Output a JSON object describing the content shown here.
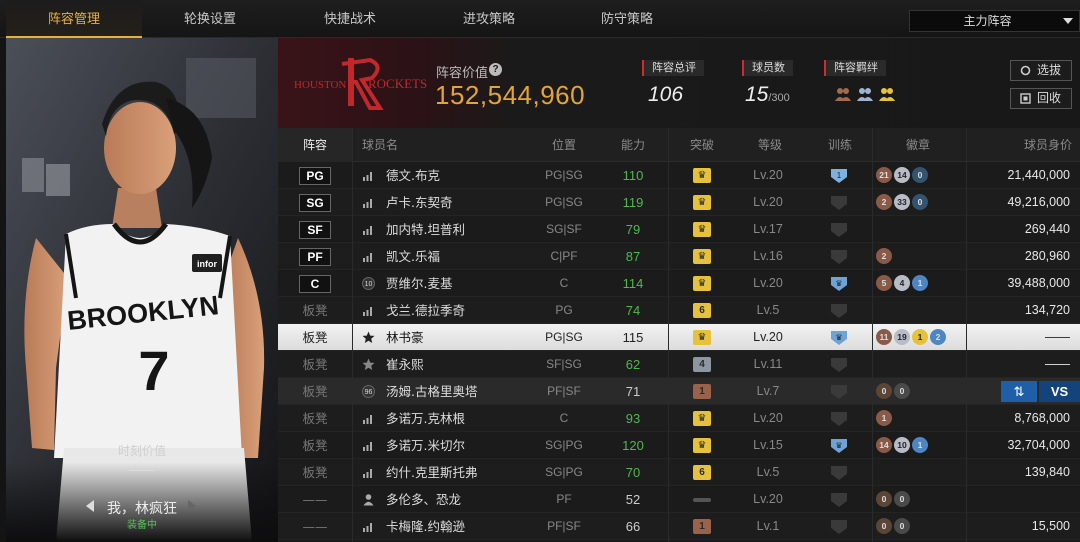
{
  "nav": {
    "tabs": [
      "阵容管理",
      "轮换设置",
      "快捷战术",
      "进攻策略",
      "防守策略"
    ],
    "active_tab": 0,
    "lineup_select": "主力阵容"
  },
  "player_card": {
    "value_label": "时刻价值",
    "value": "——",
    "name": "我，林疯狂",
    "status": "装备中",
    "jersey_text": "BROOKLYN",
    "jersey_number": "7",
    "sponsor": "infor"
  },
  "header": {
    "team_name": "ROCKETS",
    "team_prefix": "HOUSTON",
    "value_title": "阵容价值",
    "value": "152,544,960",
    "overall_label": "阵容总评",
    "overall_value": "106",
    "count_label": "球员数",
    "count_value": "15",
    "count_max": "/300",
    "bond_label": "阵容羁绊",
    "buttons": {
      "scout": "选拔",
      "recycle": "回收"
    }
  },
  "table": {
    "columns": [
      "阵容",
      "球员名",
      "位置",
      "能力",
      "突破",
      "等级",
      "训练",
      "徽章",
      "球员身价"
    ],
    "rows": [
      {
        "lineup": "PG",
        "starter": true,
        "icon": "bars",
        "name": "德文.布克",
        "pos": "PG|SG",
        "rating": "110",
        "rating_color": "#4fb84f",
        "break": "crown",
        "break_color": "#e6c23c",
        "level": "Lv.20",
        "train": "1",
        "badges": [
          {
            "t": "21",
            "c": "#8a5a48"
          },
          {
            "t": "14",
            "c": "#b7bcc6"
          },
          {
            "t": "0",
            "c": "#33536e"
          }
        ],
        "value": "21,440,000"
      },
      {
        "lineup": "SG",
        "starter": true,
        "icon": "bars",
        "name": "卢卡.东契奇",
        "pos": "PG|SG",
        "rating": "119",
        "rating_color": "#4fb84f",
        "break": "crown",
        "break_color": "#e6c23c",
        "level": "Lv.20",
        "train": "",
        "badges": [
          {
            "t": "2",
            "c": "#8a5a48"
          },
          {
            "t": "33",
            "c": "#b7bcc6"
          },
          {
            "t": "0",
            "c": "#33536e"
          }
        ],
        "value": "49,216,000"
      },
      {
        "lineup": "SF",
        "starter": true,
        "icon": "bars",
        "name": "加内特.坦普利",
        "pos": "SG|SF",
        "rating": "79",
        "rating_color": "#4fb84f",
        "break": "crown",
        "break_color": "#e6c23c",
        "level": "Lv.17",
        "train": "",
        "badges": [],
        "value": "269,440"
      },
      {
        "lineup": "PF",
        "starter": true,
        "icon": "bars",
        "name": "凯文.乐福",
        "pos": "C|PF",
        "rating": "87",
        "rating_color": "#4fb84f",
        "break": "crown",
        "break_color": "#e6c23c",
        "level": "Lv.16",
        "train": "",
        "badges": [
          {
            "t": "2",
            "c": "#8a5a48"
          }
        ],
        "value": "280,960"
      },
      {
        "lineup": "C",
        "starter": true,
        "icon": "10",
        "name": "贾维尔.麦基",
        "pos": "C",
        "rating": "114",
        "rating_color": "#4fb84f",
        "break": "crown",
        "break_color": "#e6c23c",
        "level": "Lv.20",
        "train": "crown",
        "badges": [
          {
            "t": "5",
            "c": "#8a5a48"
          },
          {
            "t": "4",
            "c": "#b7bcc6"
          },
          {
            "t": "1",
            "c": "#4d86c2"
          }
        ],
        "value": "39,488,000"
      },
      {
        "lineup": "板凳",
        "starter": false,
        "icon": "bars",
        "name": "戈兰.德拉季奇",
        "pos": "PG",
        "rating": "74",
        "rating_color": "#4fb84f",
        "break": "6",
        "break_color": "#e6c23c",
        "level": "Lv.5",
        "train": "",
        "badges": [],
        "value": "134,720"
      },
      {
        "lineup": "板凳",
        "starter": false,
        "icon": "star-dark",
        "name": "林书豪",
        "pos": "PG|SG",
        "rating": "115",
        "rating_color": "#222222",
        "break": "crown",
        "break_color": "#e6c23c",
        "level": "Lv.20",
        "train": "crown",
        "badges": [
          {
            "t": "11",
            "c": "#8a5a48"
          },
          {
            "t": "19",
            "c": "#b7bcc6"
          },
          {
            "t": "1",
            "c": "#e6c23c"
          },
          {
            "t": "2",
            "c": "#4d86c2"
          }
        ],
        "value": "——",
        "selected": true
      },
      {
        "lineup": "板凳",
        "starter": false,
        "icon": "star",
        "name": "崔永熙",
        "pos": "SF|SG",
        "rating": "62",
        "rating_color": "#4fb84f",
        "break": "4",
        "break_color": "#8d96a3",
        "level": "Lv.11",
        "train": "",
        "badges": [],
        "value": "——"
      },
      {
        "lineup": "板凳",
        "starter": false,
        "icon": "96",
        "name": "汤姆.古格里奥塔",
        "pos": "PF|SF",
        "rating": "71",
        "rating_color": "#cccccc",
        "break": "1",
        "break_color": "#9a6248",
        "level": "Lv.7",
        "train": "",
        "badges": [
          {
            "t": "0",
            "c": "#5a4536"
          },
          {
            "t": "0",
            "c": "#4a4a4a"
          }
        ],
        "value": "",
        "highlight": true
      },
      {
        "lineup": "板凳",
        "starter": false,
        "icon": "bars",
        "name": "多诺万.克林根",
        "pos": "C",
        "rating": "93",
        "rating_color": "#4fb84f",
        "break": "crown",
        "break_color": "#e6c23c",
        "level": "Lv.20",
        "train": "",
        "badges": [
          {
            "t": "1",
            "c": "#8a5a48"
          }
        ],
        "value": "8,768,000"
      },
      {
        "lineup": "板凳",
        "starter": false,
        "icon": "bars",
        "name": "多诺万.米切尔",
        "pos": "SG|PG",
        "rating": "120",
        "rating_color": "#4fb84f",
        "break": "crown",
        "break_color": "#e6c23c",
        "level": "Lv.15",
        "train": "crown",
        "badges": [
          {
            "t": "14",
            "c": "#8a5a48"
          },
          {
            "t": "10",
            "c": "#b7bcc6"
          },
          {
            "t": "1",
            "c": "#4d86c2"
          }
        ],
        "value": "32,704,000"
      },
      {
        "lineup": "板凳",
        "starter": false,
        "icon": "bars",
        "name": "约什.克里斯托弗",
        "pos": "SG|PG",
        "rating": "70",
        "rating_color": "#4fb84f",
        "break": "6",
        "break_color": "#e6c23c",
        "level": "Lv.5",
        "train": "",
        "badges": [],
        "value": "139,840"
      },
      {
        "lineup": "——",
        "starter": false,
        "icon": "person",
        "name": "多伦多、恐龙",
        "pos": "PF",
        "rating": "52",
        "rating_color": "#cccccc",
        "break": "dash",
        "break_color": "#555555",
        "level": "Lv.20",
        "train": "",
        "badges": [
          {
            "t": "0",
            "c": "#5a4536"
          },
          {
            "t": "0",
            "c": "#4a4a4a"
          }
        ],
        "value": ""
      },
      {
        "lineup": "——",
        "starter": false,
        "icon": "bars",
        "name": "卡梅隆.约翰逊",
        "pos": "PF|SF",
        "rating": "66",
        "rating_color": "#cccccc",
        "break": "1",
        "break_color": "#9a6248",
        "level": "Lv.1",
        "train": "",
        "badges": [
          {
            "t": "0",
            "c": "#5a4536"
          },
          {
            "t": "0",
            "c": "#4a4a4a"
          }
        ],
        "value": "15,500"
      }
    ],
    "row_actions": {
      "vs": "VS"
    }
  },
  "colors": {
    "accent": "#e9b13a",
    "value_gold": "#e3a534",
    "green": "#4fb84f",
    "rocket_red": "#c0282c"
  }
}
